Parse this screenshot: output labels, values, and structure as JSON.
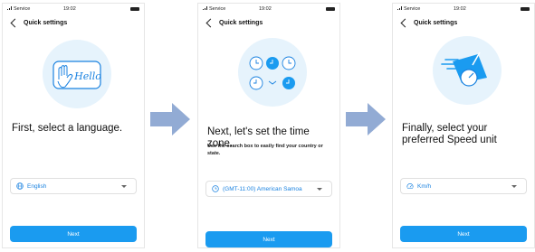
{
  "status_bar": {
    "carrier": "Service",
    "time": "19:02"
  },
  "header": {
    "title": "Quick settings"
  },
  "screens": [
    {
      "heading": "First, select a language.",
      "subtitle": "",
      "select_value": "English",
      "illustration_text": "Hello",
      "button": "Next"
    },
    {
      "heading": "Next, let's set the time zone.",
      "subtitle": "Use the search box to easily find your country or state.",
      "select_value": "(GMT-11:00) American Samoa",
      "button": "Next"
    },
    {
      "heading": "Finally, select your preferred Speed unit",
      "subtitle": "",
      "select_value": "Km/h",
      "button": "Next"
    }
  ],
  "icons": [
    "back-chevron-icon",
    "globe-icon",
    "clock-icon",
    "speedometer-icon",
    "dropdown-caret-icon",
    "arrow-right-icon"
  ],
  "colors": {
    "accent": "#1a9bf0",
    "link_text": "#1a82e0",
    "illustration_bg": "#e6f3fc",
    "arrow": "#92abd4"
  }
}
